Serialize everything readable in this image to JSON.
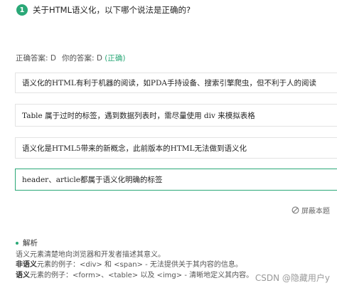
{
  "question": {
    "number": "1",
    "text": "关于HTML语义化，以下哪个说法是正确的?"
  },
  "answer": {
    "correct_label": "正确答案: D",
    "your_label": "你的答案: D",
    "status": "(正确)"
  },
  "options": [
    {
      "text": "语义化的HTML有利于机器的阅读，如PDA手持设备、搜索引擎爬虫，但不利于人的阅读",
      "selected": false
    },
    {
      "text": "Table 属于过时的标签，遇到数据列表时，需尽量使用 div 来模拟表格",
      "selected": false
    },
    {
      "text": "语义化是HTML5带来的新概念，此前版本的HTML无法做到语义化",
      "selected": false
    },
    {
      "text": "header、article都属于语义化明确的标签",
      "selected": true
    }
  ],
  "hide_button": {
    "label": "屏蔽本题"
  },
  "analysis": {
    "title": "解析",
    "line1": "语义元素清楚地向浏览器和开发者描述其意义。",
    "line2_bold": "非语义",
    "line2_rest": "元素的例子：<div> 和 <span> - 无法提供关于其内容的信息。",
    "line3_bold": "语义",
    "line3_rest": "元素的例子：<form>、<table> 以及 <img> - 清晰地定义其内容。"
  },
  "watermark": "CSDN @隐藏用户y",
  "colors": {
    "accent": "#2aa877",
    "border": "#e3e3e3"
  }
}
